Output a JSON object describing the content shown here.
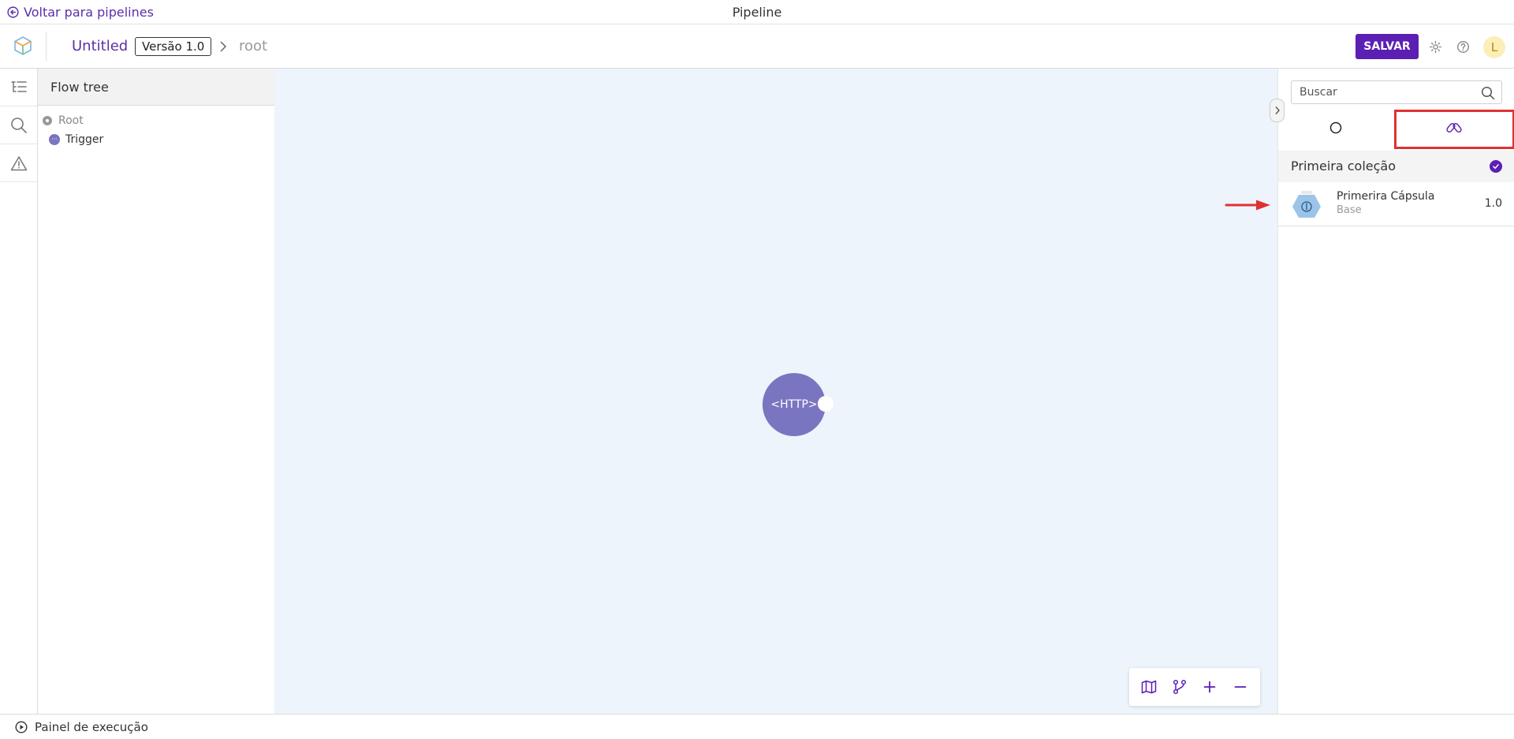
{
  "topbar": {
    "back_label": "Voltar para pipelines",
    "title": "Pipeline"
  },
  "header": {
    "pipeline_name": "Untitled",
    "version": "Versão 1.0",
    "breadcrumb_current": "root",
    "save_label": "SALVAR",
    "avatar_initial": "L"
  },
  "flow_tree": {
    "title": "Flow tree",
    "items": [
      {
        "label": "Root"
      },
      {
        "label": "Trigger",
        "icon_text": "···"
      }
    ]
  },
  "canvas": {
    "node_label": "<HTTP>"
  },
  "right_panel": {
    "search_placeholder": "Buscar",
    "collection_title": "Primeira coleção",
    "capsule": {
      "name": "Primerira Cápsula",
      "subtitle": "Base",
      "version": "1.0"
    }
  },
  "bottom": {
    "exec_label": "Painel de execução"
  },
  "colors": {
    "accent": "#5b1fb3",
    "node": "#7a75c0",
    "canvas_bg": "#edf4fc",
    "annotation": "#e03131"
  }
}
